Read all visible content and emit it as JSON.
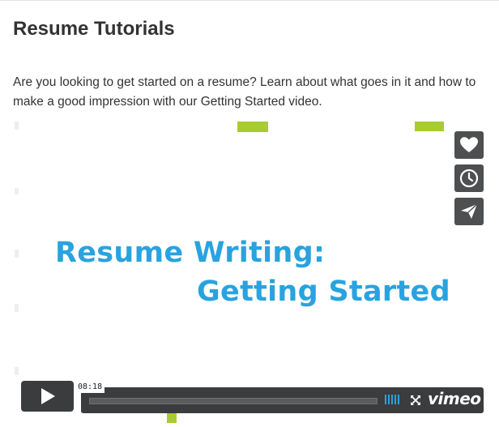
{
  "page": {
    "title": "Resume Tutorials",
    "intro": "Are you looking to get started on a resume? Learn about what goes in it and how to make a good impression with our Getting Started video."
  },
  "video": {
    "slide_line1": "Resume Writing:",
    "slide_line2": "Getting Started",
    "duration": "08:18",
    "progress": 0,
    "brand": "vimeo",
    "side_buttons": [
      {
        "icon": "heart-icon"
      },
      {
        "icon": "clock-icon"
      },
      {
        "icon": "paper-plane-icon"
      }
    ]
  },
  "colors": {
    "text": "#333333",
    "slide_blue": "#29a3df",
    "accent_green": "#a8cc2f",
    "player_dark": "#3a3c3d"
  }
}
